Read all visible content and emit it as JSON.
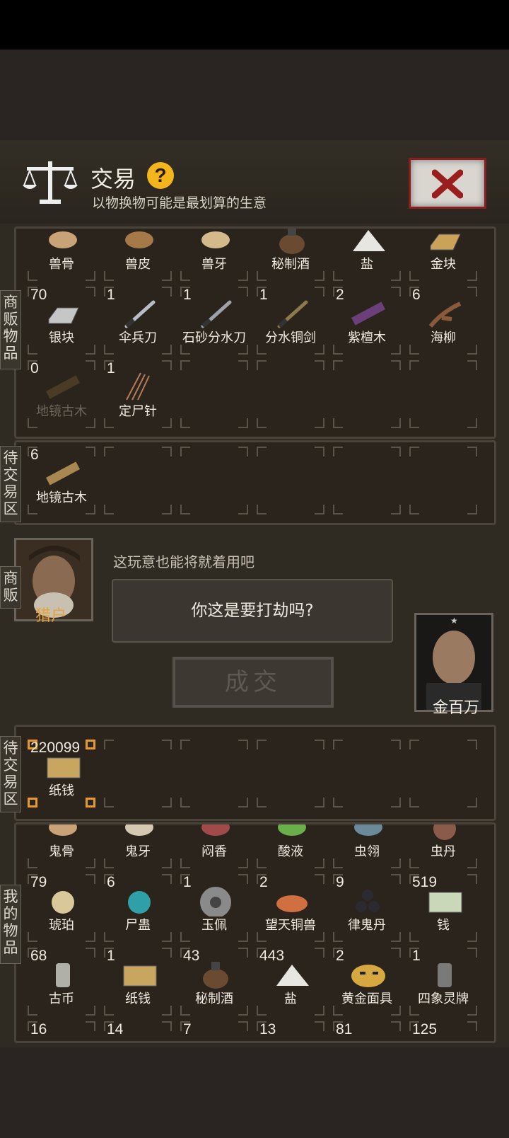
{
  "header": {
    "title": "交易",
    "help": "?",
    "subtitle": "以物换物可能是最划算的生意"
  },
  "tabs": {
    "merchant_goods": "商\n贩\n物\n品",
    "pending_top": "待\n交\n易\n区",
    "merchant": "商\n贩",
    "pending_bottom": "待\n交\n易\n区",
    "my_goods": "我\n的\n物\n品"
  },
  "merchant_rows": [
    [
      {
        "count": "",
        "name": "兽骨",
        "icon": "bone-icon",
        "color": "#c9a278"
      },
      {
        "count": "",
        "name": "兽皮",
        "icon": "hide-icon",
        "color": "#a57a48"
      },
      {
        "count": "",
        "name": "兽牙",
        "icon": "fang-icon",
        "color": "#d4b98a"
      },
      {
        "count": "",
        "name": "秘制酒",
        "icon": "wine-jar-icon",
        "color": "#6a4a30"
      },
      {
        "count": "",
        "name": "盐",
        "icon": "salt-icon",
        "color": "#e8e6e0"
      },
      {
        "count": "",
        "name": "金块",
        "icon": "gold-bar-icon",
        "color": "#caa25a"
      }
    ],
    [
      {
        "count": "70",
        "name": "银块",
        "icon": "silver-bar-icon",
        "color": "#c6c6c6"
      },
      {
        "count": "1",
        "name": "伞兵刀",
        "icon": "knife-icon",
        "color": "#b8bcc4"
      },
      {
        "count": "1",
        "name": "石砂分水刀",
        "icon": "knife-icon",
        "color": "#9ea3aa"
      },
      {
        "count": "1",
        "name": "分水铜剑",
        "icon": "sword-icon",
        "color": "#8c7a4a"
      },
      {
        "count": "2",
        "name": "紫檀木",
        "icon": "wood-icon",
        "color": "#6b3f7a"
      },
      {
        "count": "6",
        "name": "海柳",
        "icon": "branch-icon",
        "color": "#8a5a3a"
      }
    ],
    [
      {
        "count": "0",
        "name": "地镜古木",
        "icon": "wood-plank-icon",
        "color": "#4a3c24",
        "dim": true
      },
      {
        "count": "1",
        "name": "定尸针",
        "icon": "needles-icon",
        "color": "#b77a5a"
      },
      {
        "count": "",
        "name": "",
        "icon": "",
        "color": ""
      },
      {
        "count": "",
        "name": "",
        "icon": "",
        "color": ""
      },
      {
        "count": "",
        "name": "",
        "icon": "",
        "color": ""
      },
      {
        "count": "",
        "name": "",
        "icon": "",
        "color": ""
      }
    ]
  ],
  "pending_top": {
    "count": "6",
    "name": "地镜古木",
    "icon": "wood-plank-icon",
    "color": "#a88850"
  },
  "dialog": {
    "label": "这玩意也能将就着用吧",
    "bubble": "你这是要打劫吗?",
    "hunter": "猎户",
    "player": "金百万",
    "deal": "成交"
  },
  "pending_bottom": {
    "count": "220099",
    "name": "纸钱",
    "icon": "paper-money-icon",
    "color": "#c8a660"
  },
  "my_rows": [
    [
      {
        "count": "",
        "name": "鬼骨",
        "icon": "bone-icon",
        "color": "#c9a278"
      },
      {
        "count": "",
        "name": "鬼牙",
        "icon": "fang-icon",
        "color": "#d4c8b0"
      },
      {
        "count": "",
        "name": "闷香",
        "icon": "incense-icon",
        "color": "#a04a4a"
      },
      {
        "count": "",
        "name": "酸液",
        "icon": "acid-icon",
        "color": "#6ab04a"
      },
      {
        "count": "",
        "name": "虫翎",
        "icon": "feather-icon",
        "color": "#6a8a9a"
      },
      {
        "count": "",
        "name": "虫丹",
        "icon": "pill-icon",
        "color": "#8a5a4a"
      }
    ],
    [
      {
        "count": "79",
        "name": "琥珀",
        "icon": "amber-icon",
        "color": "#d8c89a"
      },
      {
        "count": "6",
        "name": "尸蛊",
        "icon": "orb-icon",
        "color": "#2fa0a8"
      },
      {
        "count": "1",
        "name": "玉佩",
        "icon": "jade-disc-icon",
        "color": "#8a8a8a"
      },
      {
        "count": "2",
        "name": "望天铜兽",
        "icon": "bronze-beast-icon",
        "color": "#d07040"
      },
      {
        "count": "9",
        "name": "律鬼丹",
        "icon": "pills-icon",
        "color": "#2a2a30"
      },
      {
        "count": "519",
        "name": "钱",
        "icon": "cash-icon",
        "color": "#c8d8b8"
      }
    ],
    [
      {
        "count": "68",
        "name": "古币",
        "icon": "coin-icon",
        "color": "#b0b0a8"
      },
      {
        "count": "1",
        "name": "纸钱",
        "icon": "paper-money-icon",
        "color": "#c8a660"
      },
      {
        "count": "43",
        "name": "秘制酒",
        "icon": "wine-jar-icon",
        "color": "#6a4a30"
      },
      {
        "count": "443",
        "name": "盐",
        "icon": "salt-icon",
        "color": "#e8e6e0"
      },
      {
        "count": "2",
        "name": "黄金面具",
        "icon": "gold-mask-icon",
        "color": "#d8a840"
      },
      {
        "count": "1",
        "name": "四象灵牌",
        "icon": "bell-icon",
        "color": "#7a7a78"
      }
    ],
    [
      {
        "count": "16",
        "name": "",
        "icon": "",
        "color": ""
      },
      {
        "count": "14",
        "name": "",
        "icon": "",
        "color": ""
      },
      {
        "count": "7",
        "name": "",
        "icon": "",
        "color": ""
      },
      {
        "count": "13",
        "name": "",
        "icon": "",
        "color": ""
      },
      {
        "count": "81",
        "name": "",
        "icon": "",
        "color": ""
      },
      {
        "count": "125",
        "name": "",
        "icon": "",
        "color": ""
      }
    ]
  ]
}
